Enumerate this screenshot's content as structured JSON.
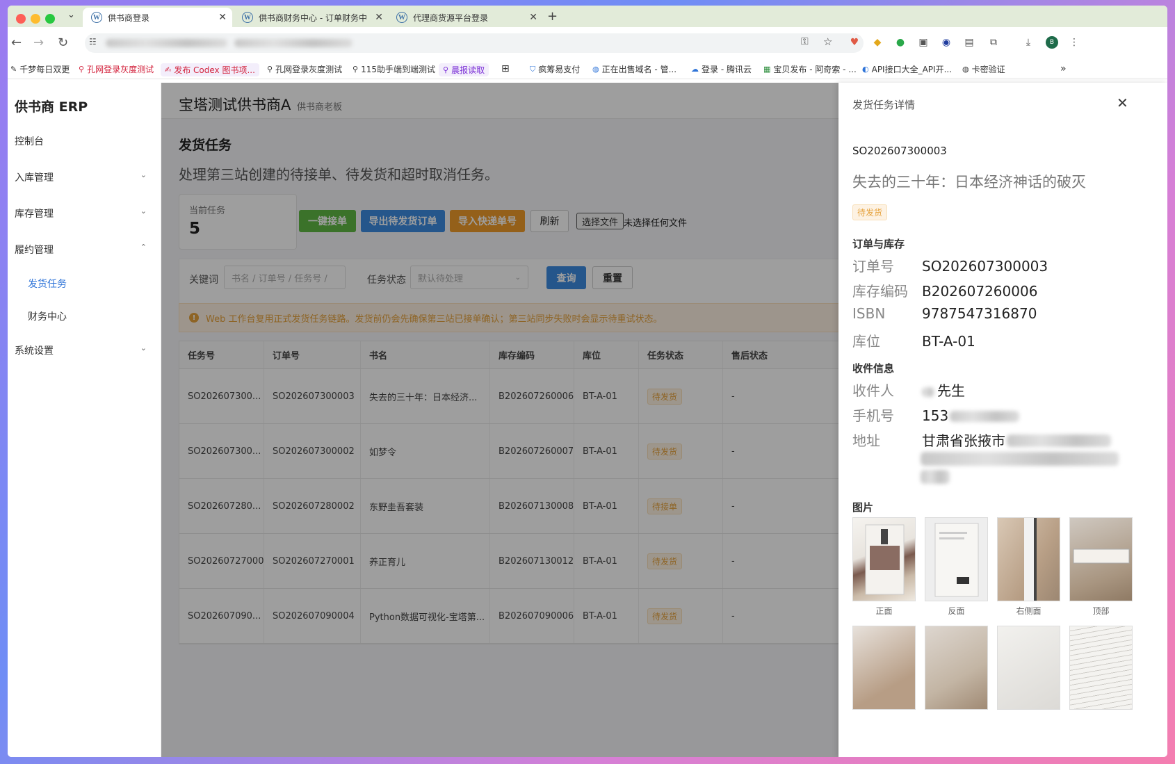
{
  "browser": {
    "tabs": [
      {
        "title": "供书商登录",
        "icon": "wordpress-icon",
        "active": true
      },
      {
        "title": "供书商财务中心 - 订单财务中",
        "icon": "wordpress-icon",
        "active": false
      },
      {
        "title": "代理商货源平台登录",
        "icon": "wordpress-icon",
        "active": false
      }
    ],
    "new_tab": "+",
    "bookmarks": [
      {
        "label": "千梦每日双更",
        "icon": "pencil-icon"
      },
      {
        "label": "孔网登录灰度测试",
        "icon": "search-icon"
      },
      {
        "label": "发布 Codex 图书项...",
        "icon": "pencil-icon"
      },
      {
        "label": "孔网登录灰度测试",
        "icon": "search-icon"
      },
      {
        "label": "115助手端到端测试",
        "icon": "search-icon"
      },
      {
        "label": "晨报读取",
        "icon": "search-icon"
      },
      {
        "label": "疯筹易支付",
        "icon": "shield-icon"
      },
      {
        "label": "正在出售域名 - 管...",
        "icon": "globe-icon"
      },
      {
        "label": "登录 - 腾讯云",
        "icon": "cloud-icon"
      },
      {
        "label": "宝贝发布 - 阿奇索 - ...",
        "icon": "shop-icon"
      },
      {
        "label": "API接口大全_API开...",
        "icon": "api-icon"
      },
      {
        "label": "卡密验证",
        "icon": "globe-icon"
      }
    ],
    "more": "»"
  },
  "sidebar": {
    "title": "供书商 ERP",
    "items": [
      {
        "label": "控制台",
        "chevron": ""
      },
      {
        "label": "入库管理",
        "chevron": "⌄"
      },
      {
        "label": "库存管理",
        "chevron": "⌄"
      },
      {
        "label": "履约管理",
        "chevron": "⌃"
      },
      {
        "label": "系统设置",
        "chevron": "⌄"
      }
    ],
    "subitems": [
      {
        "label": "发货任务",
        "active": true
      },
      {
        "label": "财务中心",
        "active": false
      }
    ]
  },
  "header": {
    "title": "宝塔测试供书商A",
    "subtitle": "供书商老板"
  },
  "page": {
    "title": "发货任务",
    "description": "处理第三站创建的待接单、待发货和超时取消任务。",
    "stat_label": "当前任务",
    "stat_value": "5",
    "buttons": {
      "accept_all": "一键接单",
      "export": "导出待发货订单",
      "import": "导入快递单号",
      "refresh": "刷新"
    },
    "file_button": "选择文件",
    "file_status": "未选择任何文件",
    "filter": {
      "keyword_label": "关键词",
      "keyword_placeholder": "书名 / 订单号 / 任务号 /",
      "status_label": "任务状态",
      "status_placeholder": "默认待处理",
      "query": "查询",
      "reset": "重置"
    },
    "alert": "Web 工作台复用正式发货任务链路。发货前仍会先确保第三站已接单确认；第三站同步失败时会显示待重试状态。"
  },
  "table": {
    "headers": [
      "任务号",
      "订单号",
      "书名",
      "库存编码",
      "库位",
      "任务状态",
      "售后状态"
    ],
    "rows": [
      [
        "SO202607300...",
        "SO202607300003",
        "失去的三十年：日本经济...",
        "B202607260006",
        "BT-A-01",
        "待发货",
        "-"
      ],
      [
        "SO202607300...",
        "SO202607300002",
        "如梦令",
        "B202607260007",
        "BT-A-01",
        "待发货",
        "-"
      ],
      [
        "SO202607280...",
        "SO202607280002",
        "东野圭吾套装",
        "B202607130008",
        "BT-A-01",
        "待接单",
        "-"
      ],
      [
        "SO20260727000...",
        "SO202607270001",
        "养正育儿",
        "B202607130012",
        "BT-A-01",
        "待发货",
        "-"
      ],
      [
        "SO202607090...",
        "SO202607090004",
        "Python数据可视化-宝塔第...",
        "B202607090006",
        "BT-A-01",
        "待发货",
        "-"
      ]
    ]
  },
  "drawer": {
    "title": "发货任务详情",
    "order_no": "SO202607300003",
    "book_title": "失去的三十年：日本经济神话的破灭",
    "status": "待发货",
    "section_order": "订单与库存",
    "fields": [
      {
        "k": "订单号",
        "v": "SO202607300003"
      },
      {
        "k": "库存编码",
        "v": "B202607260006"
      },
      {
        "k": "ISBN",
        "v": "9787547316870"
      },
      {
        "k": "库位",
        "v": "BT-A-01"
      }
    ],
    "section_recv": "收件信息",
    "recv": [
      {
        "k": "收件人",
        "v": "先生"
      },
      {
        "k": "手机号",
        "v": "153"
      },
      {
        "k": "地址",
        "v": "甘肃省张掖市"
      }
    ],
    "section_img": "图片",
    "images": [
      "正面",
      "反面",
      "右侧面",
      "顶部"
    ]
  }
}
